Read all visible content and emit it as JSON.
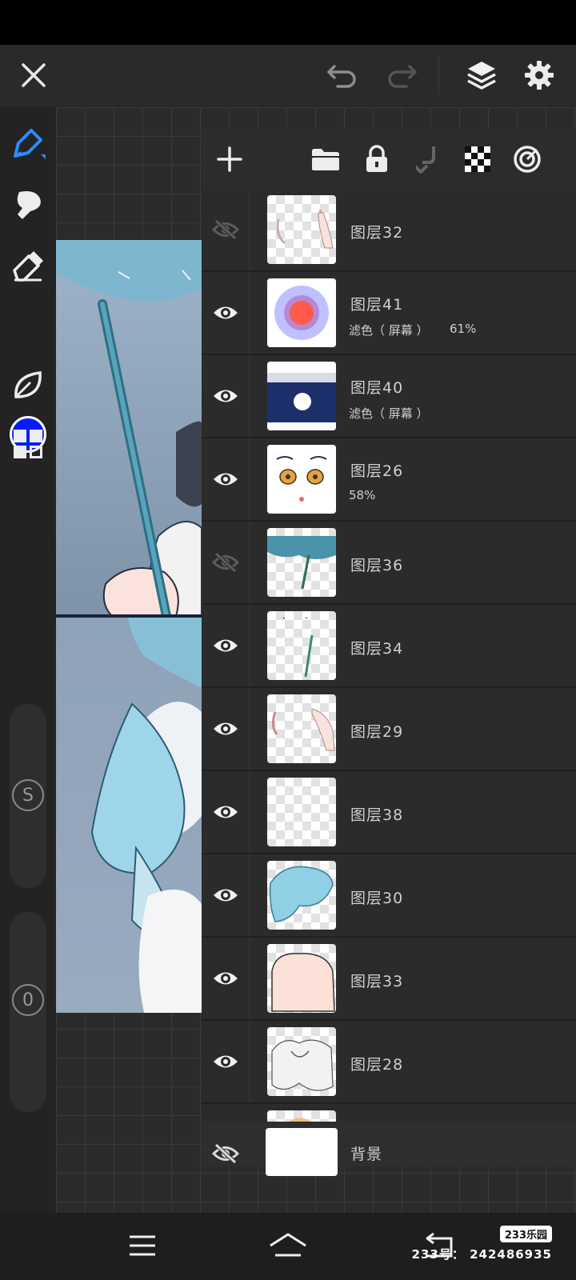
{
  "layers_panel": {
    "layers": [
      {
        "name": "图层32",
        "visible": false,
        "blend": "",
        "opacity": ""
      },
      {
        "name": "图层41",
        "visible": true,
        "blend": "滤色（ 屏幕 ）",
        "opacity": "61%"
      },
      {
        "name": "图层40",
        "visible": true,
        "blend": "滤色（ 屏幕 ）",
        "opacity": ""
      },
      {
        "name": "图层26",
        "visible": true,
        "blend": "",
        "opacity": "58%"
      },
      {
        "name": "图层36",
        "visible": false,
        "blend": "",
        "opacity": ""
      },
      {
        "name": "图层34",
        "visible": true,
        "blend": "",
        "opacity": ""
      },
      {
        "name": "图层29",
        "visible": true,
        "blend": "",
        "opacity": ""
      },
      {
        "name": "图层38",
        "visible": true,
        "blend": "",
        "opacity": ""
      },
      {
        "name": "图层30",
        "visible": true,
        "blend": "",
        "opacity": ""
      },
      {
        "name": "图层33",
        "visible": true,
        "blend": "",
        "opacity": ""
      },
      {
        "name": "图层28",
        "visible": true,
        "blend": "",
        "opacity": ""
      }
    ],
    "background_layer": {
      "name": "背景",
      "visible": false
    }
  },
  "left_toolbar": {
    "current_color": "#0a1cff",
    "size_slider_label": "S",
    "opacity_slider_label": "0"
  },
  "watermark": {
    "logo": "233乐园",
    "id_text": "233号： 242486935"
  },
  "icons": {
    "top": [
      "close-icon",
      "undo-icon",
      "redo-icon",
      "layers-icon",
      "settings-icon"
    ],
    "panel": [
      "add-layer-icon",
      "folder-icon",
      "lock-icon",
      "merge-down-icon",
      "transparency-icon",
      "target-icon"
    ],
    "tools": [
      "pen-icon",
      "smudge-icon",
      "eraser-icon",
      "color-swatch",
      "leaf-icon",
      "grid-icon"
    ],
    "nav": [
      "menu-icon",
      "home-icon",
      "back-icon"
    ]
  }
}
